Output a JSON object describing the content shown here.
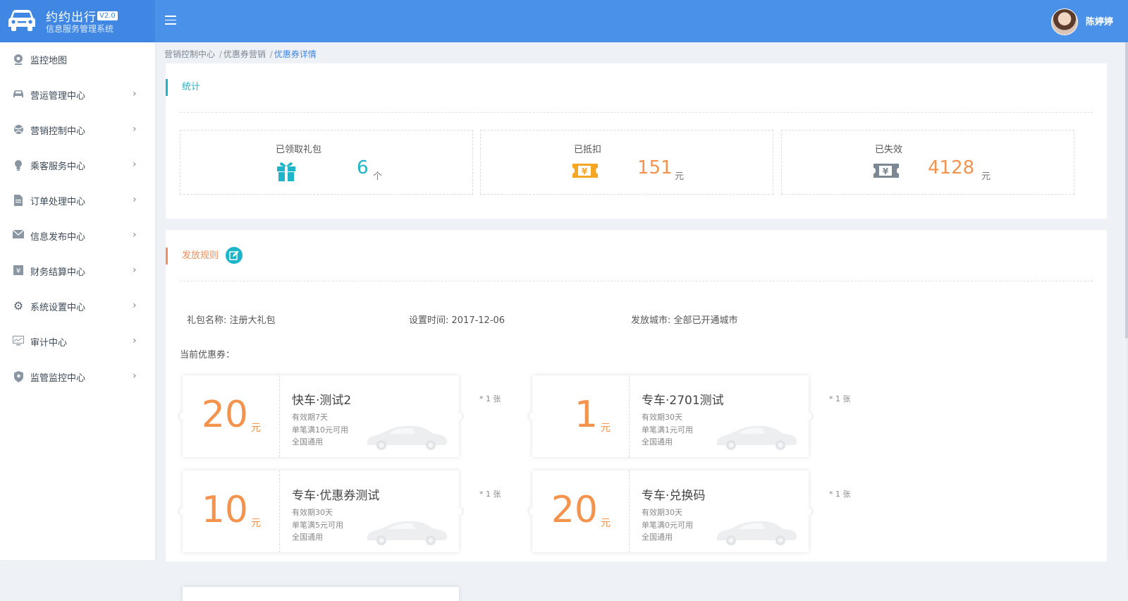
{
  "app": {
    "title": "约约出行",
    "version": "V2.0",
    "subtitle": "信息服务管理系统"
  },
  "user": {
    "name": "陈婷婷"
  },
  "sidebar": {
    "items": [
      {
        "label": "监控地图",
        "icon": "map-pin-icon"
      },
      {
        "label": "营运管理中心",
        "icon": "car-icon"
      },
      {
        "label": "营销控制中心",
        "icon": "ball-icon"
      },
      {
        "label": "乘客服务中心",
        "icon": "bulb-icon"
      },
      {
        "label": "订单处理中心",
        "icon": "file-icon"
      },
      {
        "label": "信息发布中心",
        "icon": "envelope-icon"
      },
      {
        "label": "财务结算中心",
        "icon": "yuan-box-icon"
      },
      {
        "label": "系统设置中心",
        "icon": "gear-icon"
      },
      {
        "label": "审计中心",
        "icon": "monitor-chart-icon"
      },
      {
        "label": "监管监控中心",
        "icon": "shield-icon"
      }
    ]
  },
  "breadcrumb": {
    "items": [
      "营销控制中心",
      "优惠券营销",
      "优惠券详情"
    ],
    "separator": "/"
  },
  "stats": {
    "section_title": "统计",
    "boxes": [
      {
        "label": "已领取礼包",
        "value": "6",
        "unit": "个",
        "icon": "gift-icon",
        "color": "#1fb5c8"
      },
      {
        "label": "已抵扣",
        "value": "151",
        "unit": "元",
        "icon": "ticket-icon",
        "color": "#f5a623"
      },
      {
        "label": "已失效",
        "value": "4128",
        "unit": "元",
        "icon": "expired-ticket-icon",
        "color": "#f5a623"
      }
    ]
  },
  "rules": {
    "section_title": "发放规则",
    "package_name": "礼包名称: 注册大礼包",
    "set_time": "设置时间: 2017-12-06",
    "city": "发放城市: 全部已开通城市",
    "current_label": "当前优惠券："
  },
  "coupons": [
    {
      "amount": "20",
      "unit": "元",
      "name": "快车·测试2",
      "validity": "有效期7天",
      "condition": "单笔满10元可用",
      "scope": "全国通用",
      "qty": "* 1 张"
    },
    {
      "amount": "1",
      "unit": "元",
      "name": "专车·2701测试",
      "validity": "有效期30天",
      "condition": "单笔满1元可用",
      "scope": "全国通用",
      "qty": "* 1 张"
    },
    {
      "amount": "10",
      "unit": "元",
      "name": "专车·优惠券测试",
      "validity": "有效期30天",
      "condition": "单笔满5元可用",
      "scope": "全国通用",
      "qty": "* 1 张"
    },
    {
      "amount": "20",
      "unit": "元",
      "name": "专车·兑换码",
      "validity": "有效期30天",
      "condition": "单笔满0元可用",
      "scope": "全国通用",
      "qty": "* 1 张"
    }
  ],
  "colors": {
    "header": "#4a91ea",
    "brand": "#3f87e3",
    "accent_teal": "#1fb5c8",
    "accent_orange": "#f58e5b",
    "coupon_amount": "#f4934d"
  }
}
